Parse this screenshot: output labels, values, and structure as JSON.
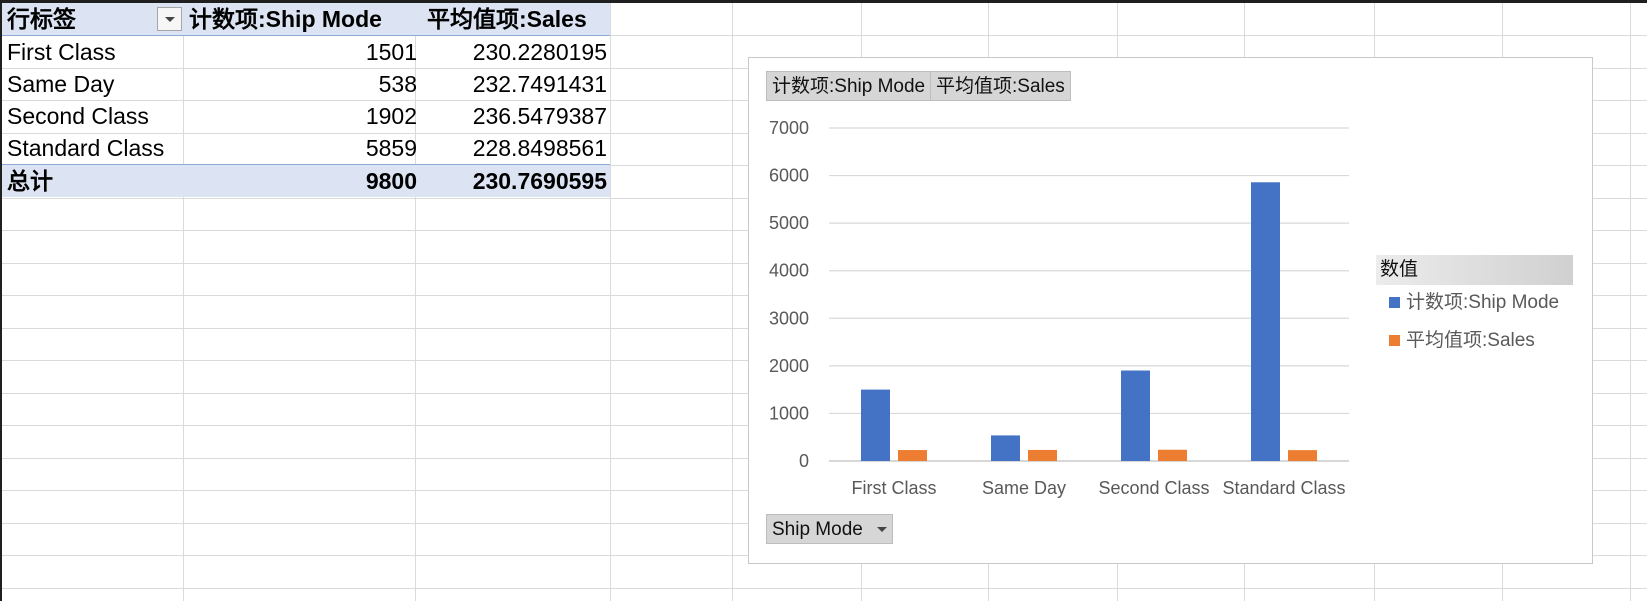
{
  "pivot": {
    "header": {
      "row_label": "行标签",
      "col_count": "计数项:Ship Mode",
      "col_avg": "平均值项:Sales"
    },
    "rows": [
      {
        "label": "First Class",
        "count": "1501",
        "avg": "230.2280195"
      },
      {
        "label": "Same Day",
        "count": "538",
        "avg": "232.7491431"
      },
      {
        "label": "Second Class",
        "count": "1902",
        "avg": "236.5479387"
      },
      {
        "label": "Standard Class",
        "count": "5859",
        "avg": "228.8498561"
      }
    ],
    "total": {
      "label": "总计",
      "count": "9800",
      "avg": "230.7690595"
    }
  },
  "chart_fields": {
    "value_btn_1": "计数项:Ship Mode",
    "value_btn_2": "平均值项:Sales",
    "axis_btn": "Ship Mode",
    "legend_title": "数值"
  },
  "colors": {
    "count": "#4472c4",
    "avg": "#ed7d31"
  },
  "chart_data": {
    "type": "bar",
    "categories": [
      "First Class",
      "Same Day",
      "Second Class",
      "Standard Class"
    ],
    "series": [
      {
        "name": "计数项:Ship Mode",
        "values": [
          1501,
          538,
          1902,
          5859
        ]
      },
      {
        "name": "平均值项:Sales",
        "values": [
          230.2280195,
          232.7491431,
          236.5479387,
          228.8498561
        ]
      }
    ],
    "ylim": [
      0,
      7000
    ],
    "yticks": [
      "0",
      "1000",
      "2000",
      "3000",
      "4000",
      "5000",
      "6000",
      "7000"
    ],
    "grid": true,
    "legend": "right"
  }
}
